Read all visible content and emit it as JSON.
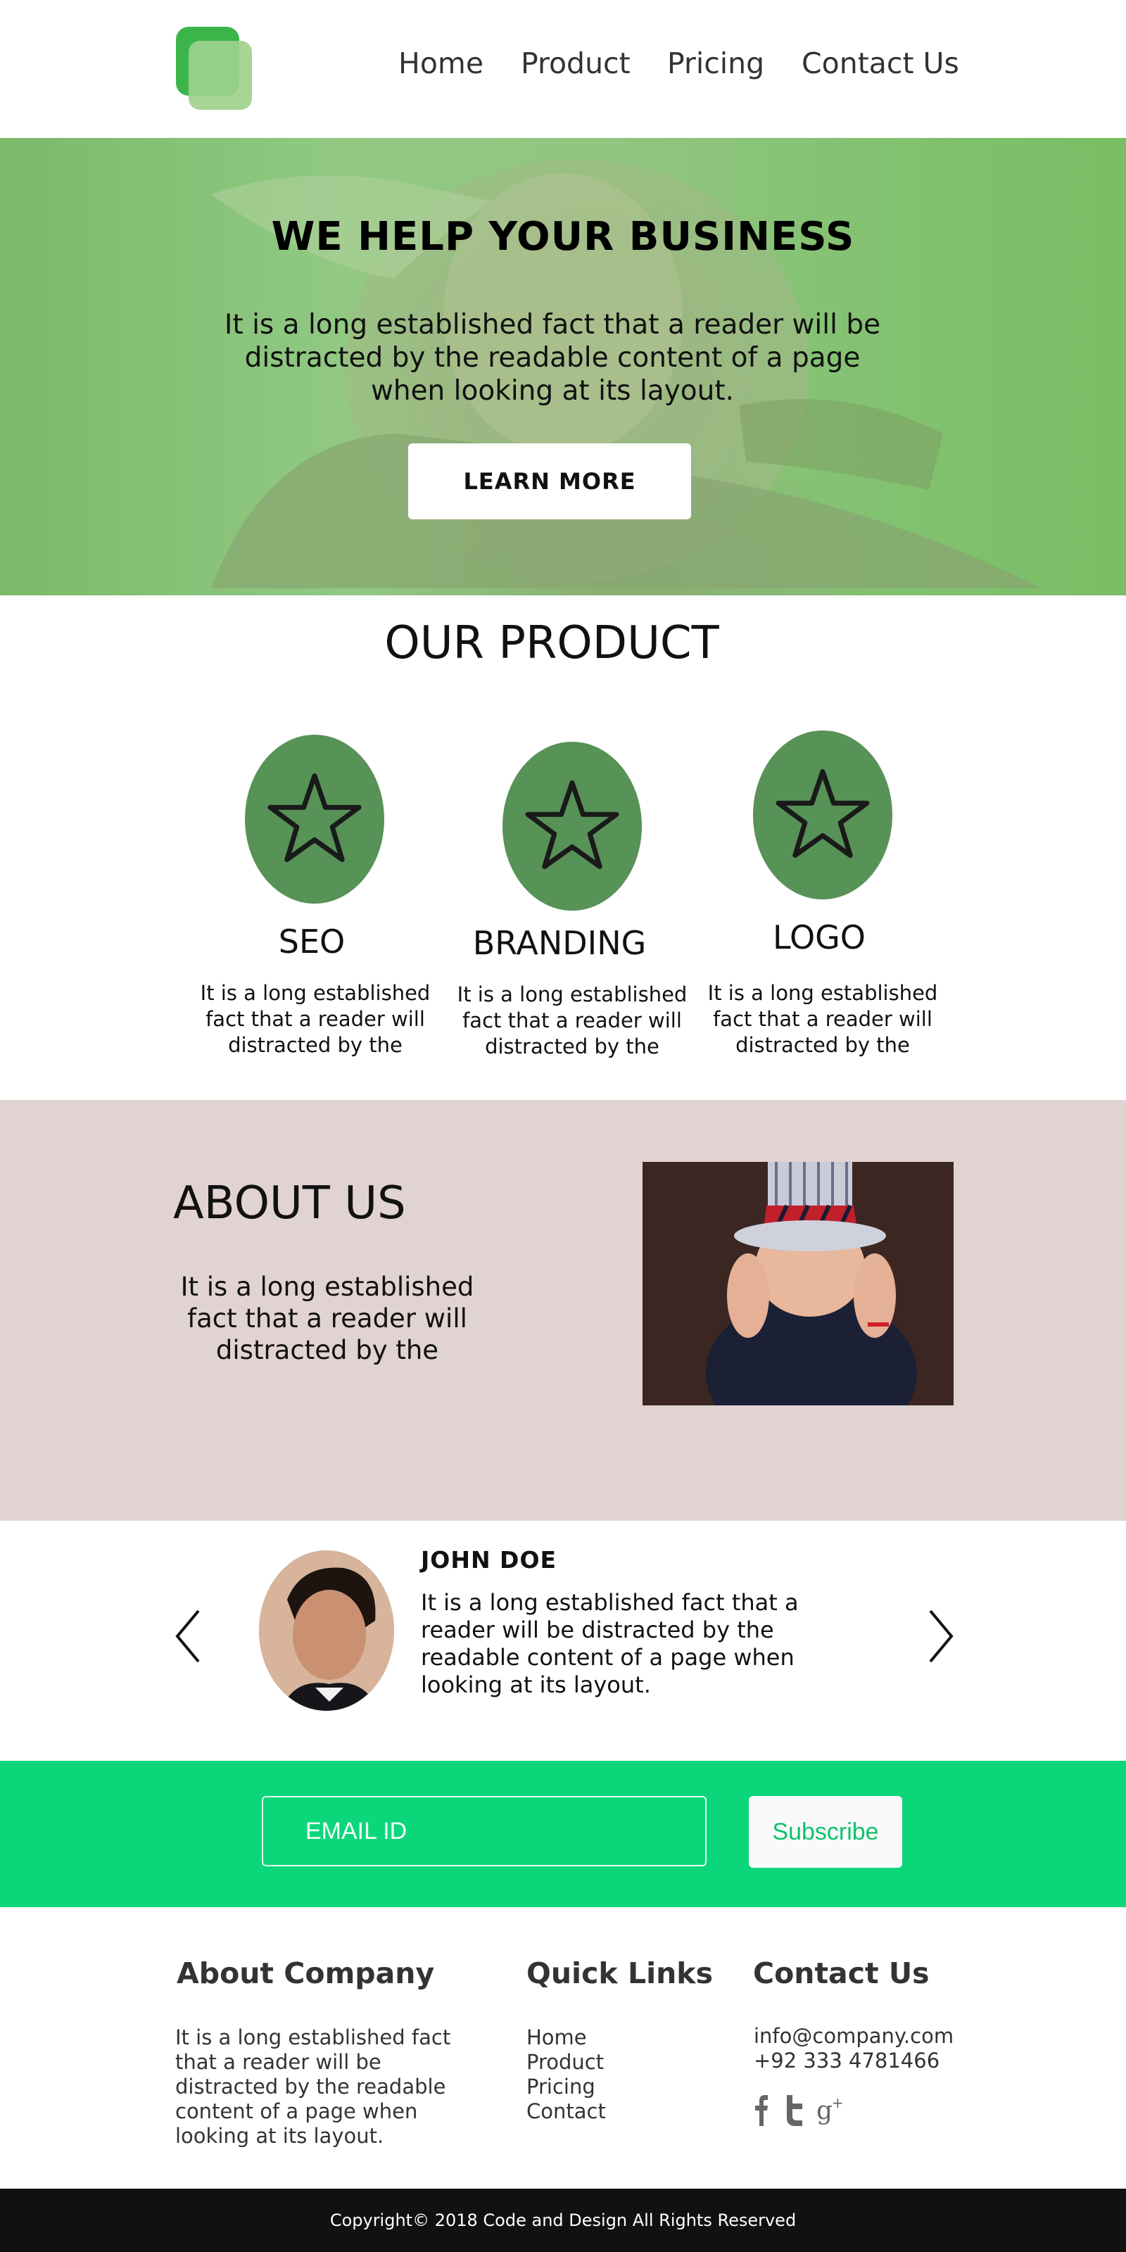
{
  "header": {
    "nav": [
      "Home",
      "Product",
      "Pricing",
      "Contact Us"
    ]
  },
  "hero": {
    "title": "WE HELP YOUR BUSINESS",
    "text": "It is a long established fact that a reader will be distracted by the readable content of a page when looking at its layout.",
    "button": "LEARN MORE"
  },
  "product": {
    "title": "OUR PRODUCT",
    "items": [
      {
        "name": "SEO",
        "text": "It is a long established fact that a reader will distracted by the",
        "icon": "star-icon"
      },
      {
        "name": "BRANDING",
        "text": "It is a long established fact that a reader will distracted by the",
        "icon": "star-icon"
      },
      {
        "name": "LOGO",
        "text": "It is a long established fact that a reader will distracted by the",
        "icon": "star-icon"
      }
    ]
  },
  "about": {
    "title": "ABOUT US",
    "text": "It is a long established fact that a reader will distracted by the"
  },
  "testimonial": {
    "name": "JOHN DOE",
    "text": "It is a long established fact that a reader will be distracted by the readable content of a page when looking at its layout."
  },
  "subscribe": {
    "placeholder": "EMAIL ID",
    "button": "Subscribe"
  },
  "footer": {
    "about_title": "About Company",
    "about_text": "It is a long established fact that a reader will be distracted by the readable content of a page when looking at its layout.",
    "links_title": "Quick Links",
    "links": [
      "Home",
      "Product",
      "Pricing",
      "Contact"
    ],
    "contact_title": "Contact Us",
    "email": "info@company.com",
    "phone": "+92 333 4781466",
    "social": [
      "facebook-icon",
      "twitter-icon",
      "google-plus-icon"
    ],
    "copyright": "Copyright©  2018 Code and Design All Rights Reserved"
  },
  "colors": {
    "accent_green": "#0bd77a",
    "product_circle": "#579257",
    "about_bg": "#e2d3d3",
    "footer_bg": "#111111"
  }
}
